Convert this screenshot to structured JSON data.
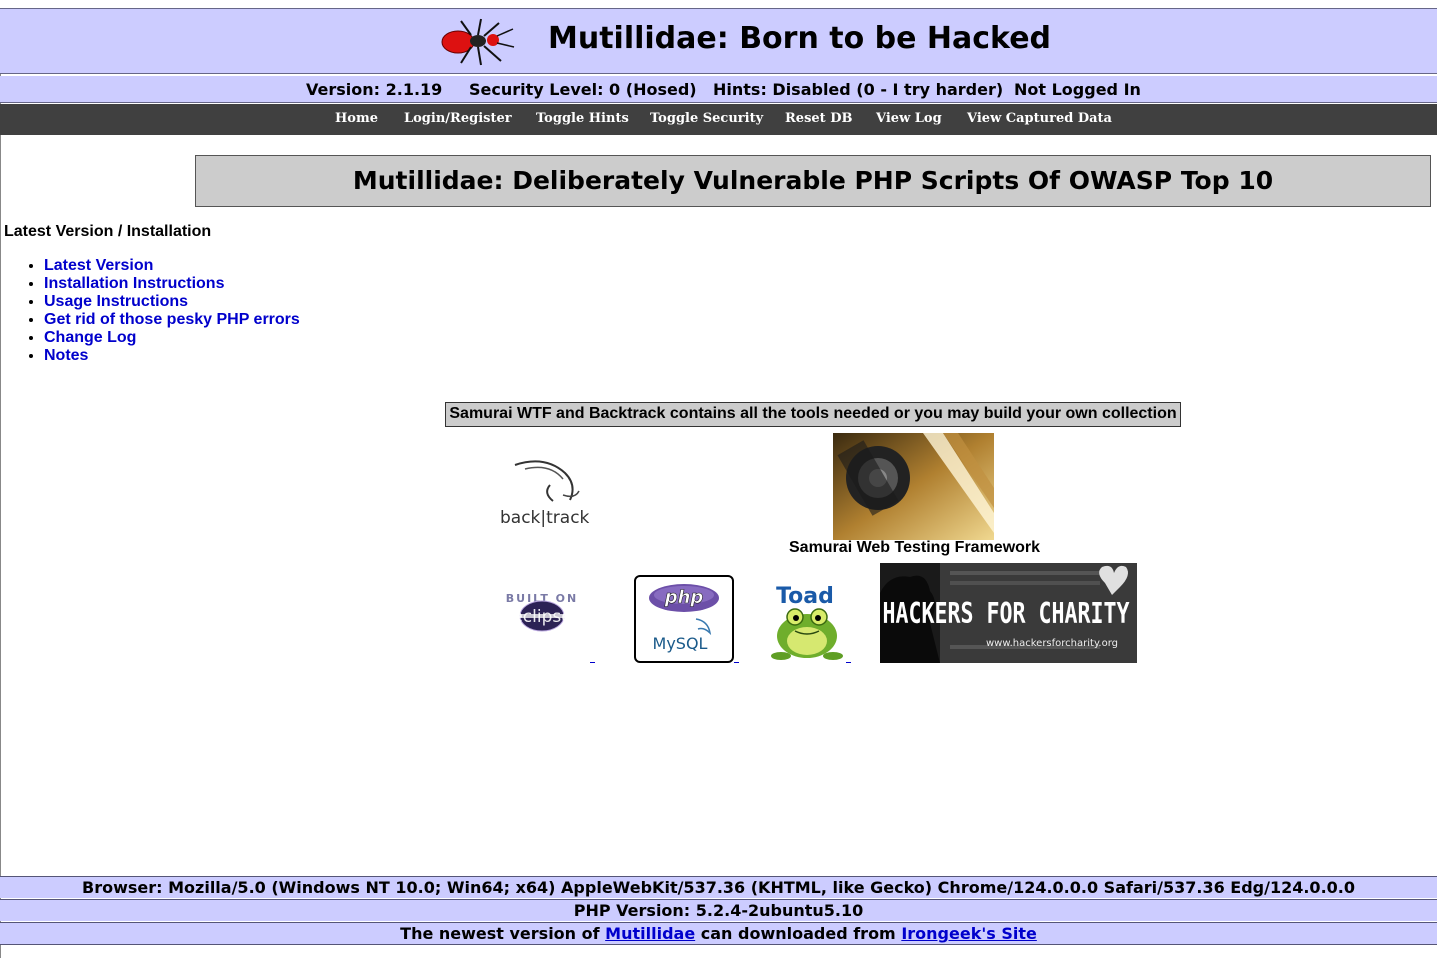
{
  "header": {
    "title": "Mutillidae: Born to be Hacked",
    "logo_icon": "ant-logo-icon"
  },
  "status": {
    "version": "Version: 2.1.19",
    "security_level": "Security Level: 0 (Hosed)",
    "hints": "Hints: Disabled (0 - I try harder)",
    "login_state": "Not Logged In"
  },
  "nav": {
    "items": [
      "Home",
      "Login/Register",
      "Toggle Hints",
      "Toggle Security",
      "Reset DB",
      "View Log",
      "View Captured Data"
    ]
  },
  "main": {
    "page_title": "Mutillidae: Deliberately Vulnerable PHP Scripts Of OWASP Top 10",
    "section_heading": "Latest Version / Installation",
    "links": [
      "Latest Version",
      "Installation Instructions",
      "Usage Instructions",
      "Get rid of those pesky PHP errors",
      "Change Log",
      "Notes"
    ],
    "tools_caption": "Samurai WTF and Backtrack contains all the tools needed or you may build your own collection",
    "backtrack_text": "back|track",
    "samurai_caption": "Samurai Web Testing Framework",
    "eclipse_top": "BUILT ON",
    "eclipse_word": "eclipse",
    "php_text": "php",
    "mysql_text": "MySQL",
    "toad_text": "Toad",
    "hfc_text": "HACKERS FOR CHARITY",
    "hfc_url": "www.hackersforcharity.org"
  },
  "footer": {
    "browser": "Browser: Mozilla/5.0 (Windows NT 10.0; Win64; x64) AppleWebKit/537.36 (KHTML, like Gecko) Chrome/124.0.0.0 Safari/537.36 Edg/124.0.0.0",
    "php_version": "PHP Version: 5.2.4-2ubuntu5.10",
    "newest_prefix": "The newest version of",
    "mutillidae_link": "Mutillidae",
    "newest_middle": "can downloaded from",
    "irongeek_link": "Irongeek's Site"
  },
  "colors": {
    "header_bg": "#ccccff",
    "nav_bg": "#404040",
    "link": "#0000cc",
    "title_box_bg": "#cccccc"
  }
}
